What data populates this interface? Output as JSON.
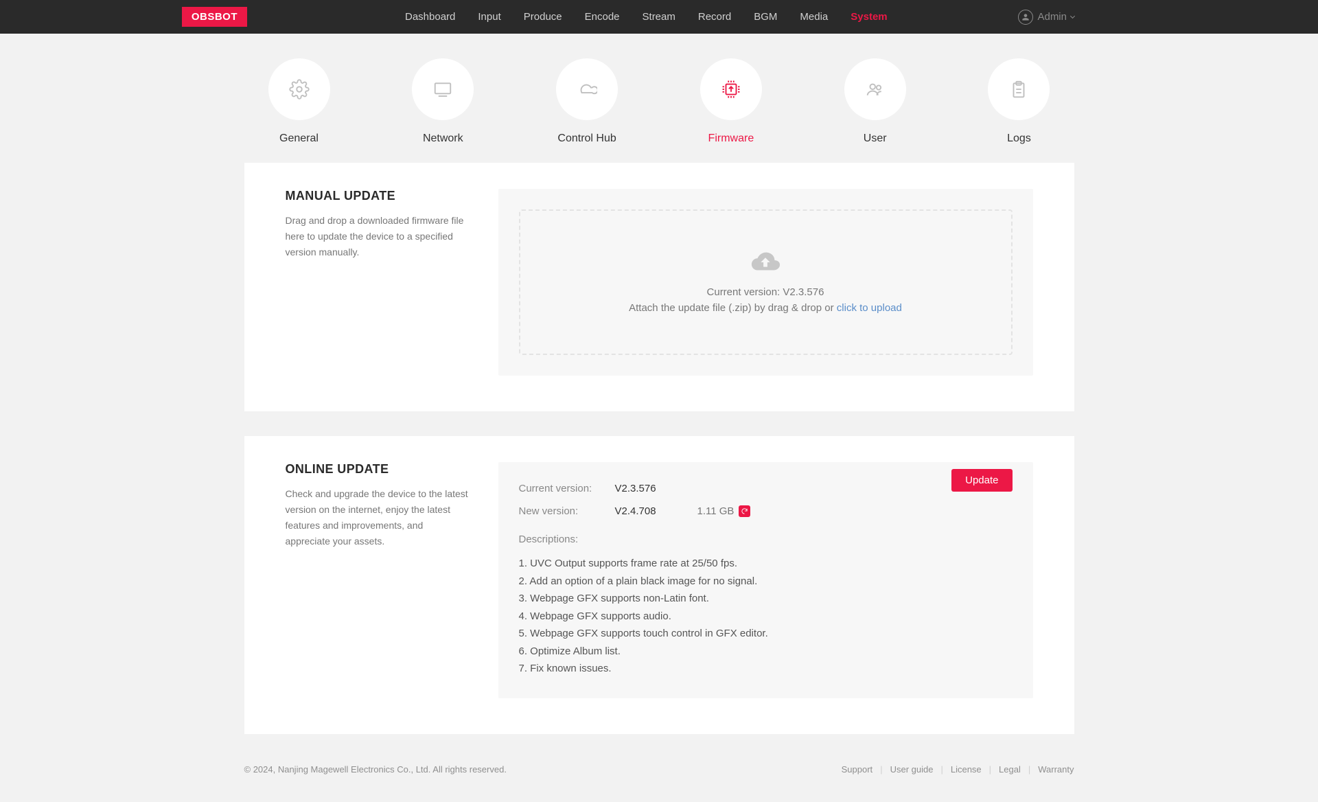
{
  "brand": "OBSBOT",
  "topnav": [
    "Dashboard",
    "Input",
    "Produce",
    "Encode",
    "Stream",
    "Record",
    "BGM",
    "Media",
    "System"
  ],
  "topnav_active": "System",
  "user": "Admin",
  "subtabs": [
    "General",
    "Network",
    "Control Hub",
    "Firmware",
    "User",
    "Logs"
  ],
  "subtab_active": "Firmware",
  "manual": {
    "title": "MANUAL UPDATE",
    "desc": "Drag and drop a downloaded firmware file here to update the device to a specified version manually.",
    "current_label": "Current version:",
    "current_version": "V2.3.576",
    "attach_text": "Attach the update file (.zip) by drag & drop or ",
    "link": "click to upload"
  },
  "online": {
    "title": "ONLINE UPDATE",
    "desc": "Check and upgrade the device to the latest version on the internet, enjoy the latest features and improvements, and appreciate your assets.",
    "cur_label": "Current version:",
    "cur": "V2.3.576",
    "new_label": "New version:",
    "new": "V2.4.708",
    "size": "1.11 GB",
    "update_btn": "Update",
    "desc_head": "Descriptions:",
    "list": [
      "1. UVC Output supports frame rate at 25/50 fps.",
      "2. Add an option of a plain black image for no signal.",
      "3. Webpage GFX supports non-Latin font.",
      "4. Webpage GFX supports audio.",
      "5. Webpage GFX supports touch control in GFX editor.",
      "6. Optimize Album list.",
      "7. Fix known issues."
    ]
  },
  "footer": {
    "copy": "© 2024, Nanjing Magewell Electronics Co., Ltd. All rights reserved.",
    "links": [
      "Support",
      "User guide",
      "License",
      "Legal",
      "Warranty"
    ]
  }
}
